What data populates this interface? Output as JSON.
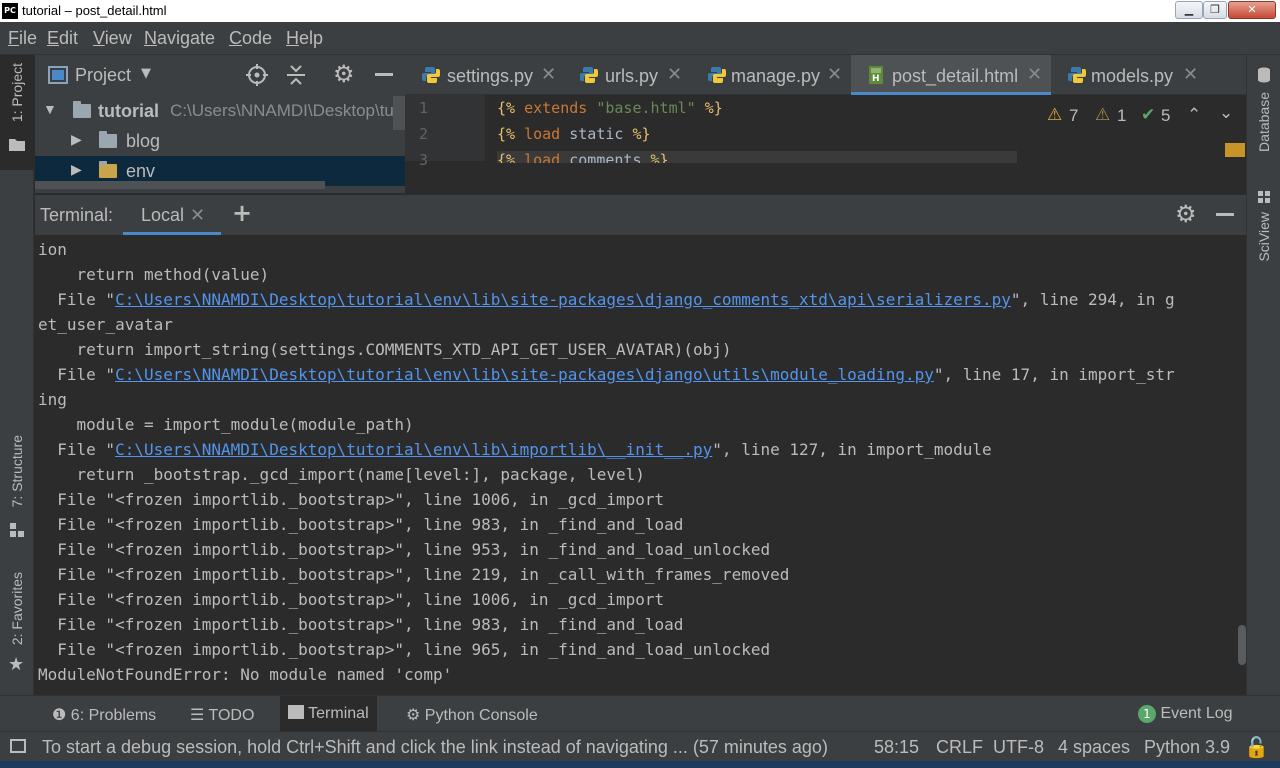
{
  "window": {
    "app_icon_text": "PC",
    "title": "tutorial – post_detail.html"
  },
  "menu": {
    "items": [
      {
        "label": "File",
        "mnemonic": "F"
      },
      {
        "label": "Edit",
        "mnemonic": "E"
      },
      {
        "label": "View",
        "mnemonic": "V"
      },
      {
        "label": "Navigate",
        "mnemonic": "N"
      },
      {
        "label": "Code",
        "mnemonic": "C"
      },
      {
        "label": "Help",
        "mnemonic": "H"
      }
    ]
  },
  "left_stripe": {
    "project_tab": "1: Project",
    "structure_tab": "7: Structure",
    "favorites_tab": "2: Favorites"
  },
  "right_stripe": {
    "database_tab": "Database",
    "sciview_tab": "SciView"
  },
  "project_panel": {
    "header": "Project",
    "tree": [
      {
        "name": "tutorial",
        "path": "C:\\Users\\NNAMDI\\Desktop\\tu",
        "expanded": true
      },
      {
        "name": "blog",
        "expanded": false
      },
      {
        "name": "env",
        "expanded": false
      }
    ]
  },
  "editor": {
    "tabs": [
      {
        "label": "settings.py",
        "active": false,
        "icon": "python-icon"
      },
      {
        "label": "urls.py",
        "active": false,
        "icon": "python-icon"
      },
      {
        "label": "manage.py",
        "active": false,
        "icon": "python-icon"
      },
      {
        "label": "post_detail.html",
        "active": true,
        "icon": "html-icon"
      },
      {
        "label": "models.py",
        "active": false,
        "icon": "python-icon"
      }
    ],
    "line_numbers": [
      "1",
      "2",
      "3"
    ],
    "inspections": {
      "warnings": "7",
      "weak_warnings": "1",
      "ok": "5"
    }
  },
  "terminal": {
    "title": "Terminal:",
    "tab": "Local",
    "lines": [
      [
        {
          "t": "ion"
        }
      ],
      [
        {
          "t": "    return method(value)"
        }
      ],
      [
        {
          "t": "  File \""
        },
        {
          "t": "C:\\Users\\NNAMDI\\Desktop\\tutorial\\env\\lib\\site-packages\\django_comments_xtd\\api\\serializers.py",
          "link": true
        },
        {
          "t": "\", line 294, in g"
        }
      ],
      [
        {
          "t": "et_user_avatar"
        }
      ],
      [
        {
          "t": "    return import_string(settings.COMMENTS_XTD_API_GET_USER_AVATAR)(obj)"
        }
      ],
      [
        {
          "t": "  File \""
        },
        {
          "t": "C:\\Users\\NNAMDI\\Desktop\\tutorial\\env\\lib\\site-packages\\django\\utils\\module_loading.py",
          "link": true
        },
        {
          "t": "\", line 17, in import_str"
        }
      ],
      [
        {
          "t": "ing"
        }
      ],
      [
        {
          "t": "    module = import_module(module_path)"
        }
      ],
      [
        {
          "t": "  File \""
        },
        {
          "t": "C:\\Users\\NNAMDI\\Desktop\\tutorial\\env\\lib\\importlib\\__init__.py",
          "link": true
        },
        {
          "t": "\", line 127, in import_module"
        }
      ],
      [
        {
          "t": "    return _bootstrap._gcd_import(name[level:], package, level)"
        }
      ],
      [
        {
          "t": "  File \"<frozen importlib._bootstrap>\", line 1006, in _gcd_import"
        }
      ],
      [
        {
          "t": "  File \"<frozen importlib._bootstrap>\", line 983, in _find_and_load"
        }
      ],
      [
        {
          "t": "  File \"<frozen importlib._bootstrap>\", line 953, in _find_and_load_unlocked"
        }
      ],
      [
        {
          "t": "  File \"<frozen importlib._bootstrap>\", line 219, in _call_with_frames_removed"
        }
      ],
      [
        {
          "t": "  File \"<frozen importlib._bootstrap>\", line 1006, in _gcd_import"
        }
      ],
      [
        {
          "t": "  File \"<frozen importlib._bootstrap>\", line 983, in _find_and_load"
        }
      ],
      [
        {
          "t": "  File \"<frozen importlib._bootstrap>\", line 965, in _find_and_load_unlocked"
        }
      ],
      [
        {
          "t": "ModuleNotFoundError: No module named 'comp'"
        }
      ]
    ]
  },
  "bottom_tools": {
    "problems": "6: Problems",
    "todo": "TODO",
    "terminal": "Terminal",
    "python_console": "Python Console",
    "event_log": "Event Log",
    "event_count": "1"
  },
  "status": {
    "message": "To start a debug session, hold Ctrl+Shift and click the link instead of navigating ... (57 minutes ago)",
    "position": "58:15",
    "line_sep": "CRLF",
    "encoding": "UTF-8",
    "indent": "4 spaces",
    "interpreter": "Python 3.9"
  },
  "colors": {
    "background": "#2b2b2b",
    "panel": "#3c3f41",
    "link": "#5394ec",
    "accent": "#4a88c7"
  }
}
